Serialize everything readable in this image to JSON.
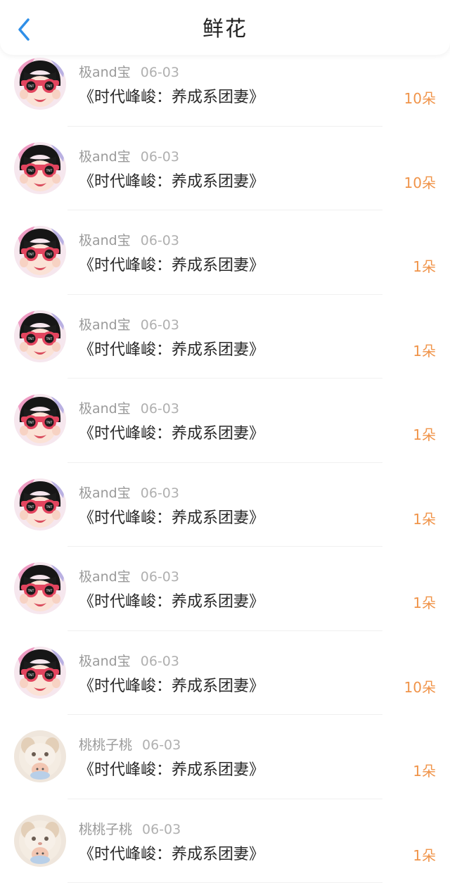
{
  "header": {
    "title": "鲜花",
    "back_icon": "chevron-left-icon",
    "accent_color": "#2f8fe8"
  },
  "amount_color": "#f0944a",
  "items": [
    {
      "user": "极and宝",
      "date": "06-03",
      "book": "《时代峰峻：养成系团妻》",
      "amount": "10朵",
      "avatar": "tnt-girl-avatar"
    },
    {
      "user": "极and宝",
      "date": "06-03",
      "book": "《时代峰峻：养成系团妻》",
      "amount": "10朵",
      "avatar": "tnt-girl-avatar"
    },
    {
      "user": "极and宝",
      "date": "06-03",
      "book": "《时代峰峻：养成系团妻》",
      "amount": "1朵",
      "avatar": "tnt-girl-avatar"
    },
    {
      "user": "极and宝",
      "date": "06-03",
      "book": "《时代峰峻：养成系团妻》",
      "amount": "1朵",
      "avatar": "tnt-girl-avatar"
    },
    {
      "user": "极and宝",
      "date": "06-03",
      "book": "《时代峰峻：养成系团妻》",
      "amount": "1朵",
      "avatar": "tnt-girl-avatar"
    },
    {
      "user": "极and宝",
      "date": "06-03",
      "book": "《时代峰峻：养成系团妻》",
      "amount": "1朵",
      "avatar": "tnt-girl-avatar"
    },
    {
      "user": "极and宝",
      "date": "06-03",
      "book": "《时代峰峻：养成系团妻》",
      "amount": "1朵",
      "avatar": "tnt-girl-avatar"
    },
    {
      "user": "极and宝",
      "date": "06-03",
      "book": "《时代峰峻：养成系团妻》",
      "amount": "10朵",
      "avatar": "tnt-girl-avatar"
    },
    {
      "user": "桃桃子桃",
      "date": "06-03",
      "book": "《时代峰峻：养成系团妻》",
      "amount": "1朵",
      "avatar": "cat-avatar"
    },
    {
      "user": "桃桃子桃",
      "date": "06-03",
      "book": "《时代峰峻：养成系团妻》",
      "amount": "1朵",
      "avatar": "cat-avatar"
    }
  ]
}
